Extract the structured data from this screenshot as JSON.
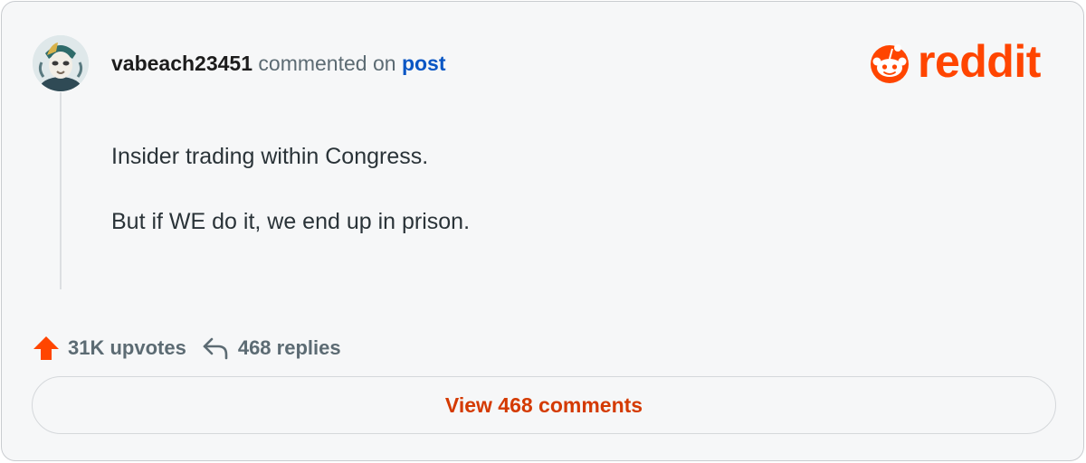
{
  "comment": {
    "username": "vabeach23451",
    "verb": "commented on",
    "target_link": "post",
    "paragraphs": [
      "Insider trading within Congress.",
      "But if WE do it, we end up in prison."
    ]
  },
  "brand": {
    "logo_text": "reddit",
    "icon": "reddit-snoo-icon",
    "color": "#ff4500"
  },
  "stats": {
    "upvotes": "31K upvotes",
    "replies": "468 replies",
    "upvote_icon": "upvote-arrow-icon",
    "reply_icon": "reply-arrow-icon",
    "upvote_color": "#ff4500"
  },
  "actions": {
    "view_comments_label": "View 468 comments"
  },
  "colors": {
    "link": "#0a56c4",
    "muted": "#5c6b73",
    "button_text": "#d43a00"
  }
}
